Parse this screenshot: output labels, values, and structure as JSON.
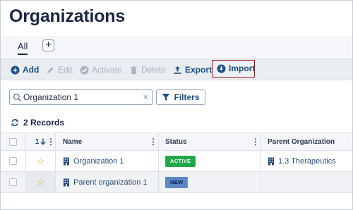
{
  "page": {
    "title": "Organizations"
  },
  "tabs": {
    "all_label": "All",
    "add_label": "+"
  },
  "toolbar": {
    "add": "Add",
    "edit": "Edit",
    "activate": "Activate",
    "delete": "Delete",
    "export": "Export",
    "import": "Import"
  },
  "search": {
    "value": "Organization 1",
    "clear_label": "×"
  },
  "filters": {
    "label": "Filters"
  },
  "records": {
    "label": "2 Records"
  },
  "grid": {
    "headers": {
      "sort_label": "1",
      "name": "Name",
      "status": "Status",
      "parent": "Parent Organization"
    },
    "rows": [
      {
        "name": "Organization 1",
        "status": "ACTIVE",
        "parent": "1.3 Therapeutics"
      },
      {
        "name": "Parent organization 1",
        "status": "NEW",
        "parent": ""
      }
    ]
  },
  "icons": {
    "add": "plus-circle-icon",
    "edit": "pencil-icon",
    "activate": "check-circle-icon",
    "delete": "trash-icon",
    "export": "upload-icon",
    "import": "download-circle-icon",
    "search": "search-icon",
    "filters": "funnel-icon",
    "refresh": "refresh-icon",
    "building": "building-icon",
    "star": "star-outline-icon"
  },
  "colors": {
    "accent": "#1e4f86",
    "title": "#1a2744",
    "import_highlight": "#9c1a1a",
    "active_badge": "#22a84a",
    "new_badge": "#5b87c8",
    "star": "#e6a817"
  }
}
